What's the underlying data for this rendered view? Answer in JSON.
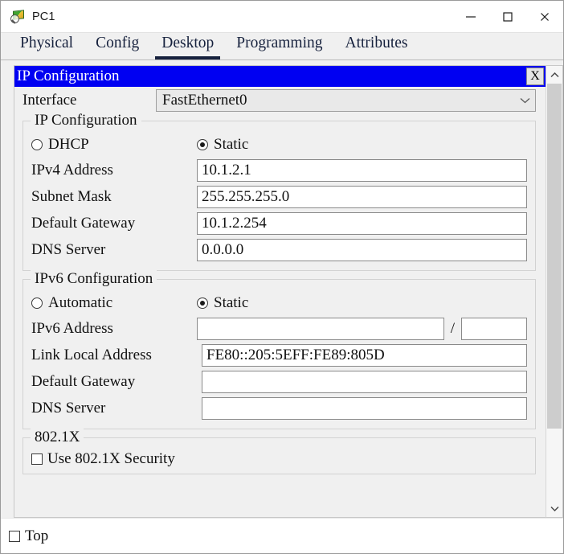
{
  "window": {
    "title": "PC1",
    "icon": "packet-tracer-pc-icon",
    "minimize_label": "–",
    "maximize_label": "□",
    "close_label": "✕"
  },
  "tabs": [
    {
      "label": "Physical",
      "active": false
    },
    {
      "label": "Config",
      "active": false
    },
    {
      "label": "Desktop",
      "active": true
    },
    {
      "label": "Programming",
      "active": false
    },
    {
      "label": "Attributes",
      "active": false
    }
  ],
  "dialog": {
    "title": "IP Configuration",
    "close_label": "X",
    "title_bg": "#0000f2",
    "title_fg": "#ffffff"
  },
  "interface": {
    "label": "Interface",
    "value": "FastEthernet0",
    "chevron": "⌄"
  },
  "ipv4": {
    "legend": "IP Configuration",
    "mode_dhcp_label": "DHCP",
    "mode_dhcp_selected": false,
    "mode_static_label": "Static",
    "mode_static_selected": true,
    "fields": [
      {
        "label": "IPv4 Address",
        "value": "10.1.2.1"
      },
      {
        "label": "Subnet Mask",
        "value": "255.255.255.0"
      },
      {
        "label": "Default Gateway",
        "value": "10.1.2.254"
      },
      {
        "label": "DNS Server",
        "value": "0.0.0.0"
      }
    ]
  },
  "ipv6": {
    "legend": "IPv6 Configuration",
    "mode_auto_label": "Automatic",
    "mode_auto_selected": false,
    "mode_static_label": "Static",
    "mode_static_selected": true,
    "address_label": "IPv6 Address",
    "address_value": "",
    "prefix_separator": "/",
    "prefix_value": "",
    "fields": [
      {
        "label": "Link Local Address",
        "value": "FE80::205:5EFF:FE89:805D"
      },
      {
        "label": "Default Gateway",
        "value": ""
      },
      {
        "label": "DNS Server",
        "value": ""
      }
    ]
  },
  "dot1x": {
    "legend": "802.1X",
    "use_security_label": "Use 802.1X Security",
    "use_security_checked": false
  },
  "footer": {
    "top_label": "Top",
    "top_checked": false
  },
  "scrollbar": {
    "up_arrow": "⌃",
    "down_arrow": "⌄"
  }
}
